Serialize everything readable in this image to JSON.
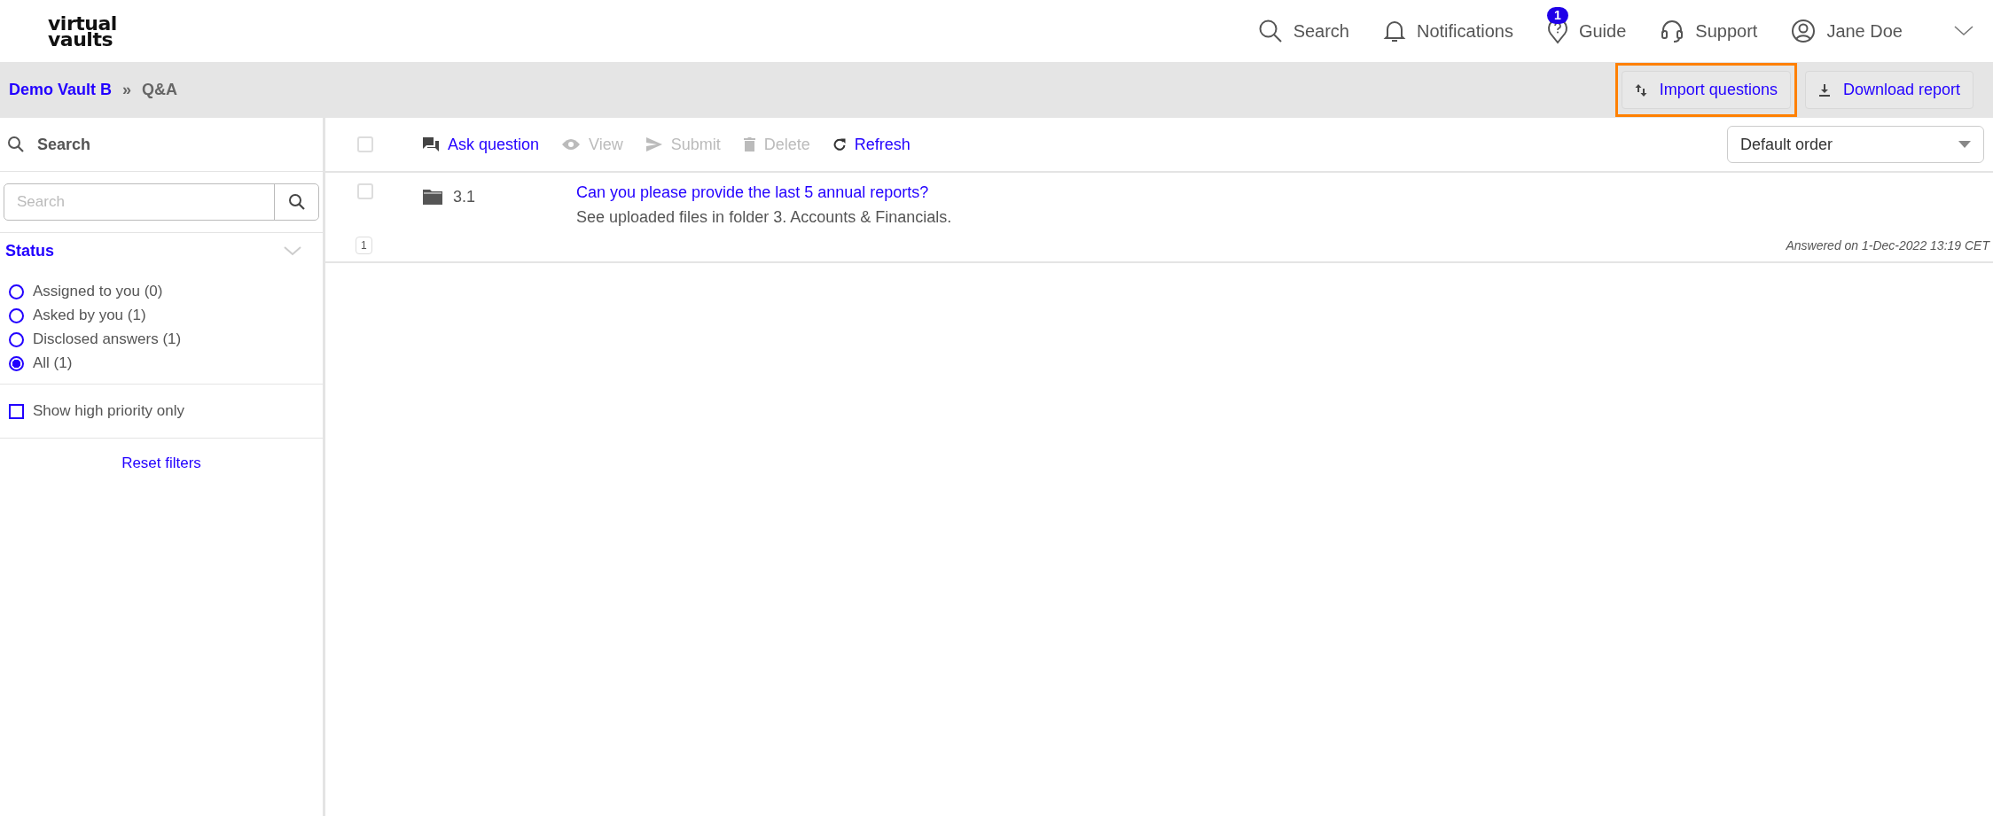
{
  "logo": {
    "lines": [
      "virtual",
      "vaults"
    ]
  },
  "nav": [
    {
      "kind": "search",
      "label": "Search"
    },
    {
      "kind": "bell",
      "label": "Notifications"
    },
    {
      "kind": "guide",
      "label": "Guide",
      "badge": "1"
    },
    {
      "kind": "headset",
      "label": "Support"
    },
    {
      "kind": "user",
      "label": "Jane Doe"
    }
  ],
  "breadcrumb": {
    "parent": "Demo Vault B",
    "separator": "»",
    "current": "Q&A"
  },
  "header_actions": [
    {
      "kind": "import",
      "label": "Import questions",
      "highlighted": true
    },
    {
      "kind": "download",
      "label": "Download report",
      "highlighted": false
    }
  ],
  "sidebar": {
    "title": "Search",
    "search": {
      "placeholder": "Search"
    },
    "status_title": "Status",
    "options": [
      {
        "label": "Assigned to you (0)",
        "selected": false
      },
      {
        "label": "Asked by you (1)",
        "selected": false
      },
      {
        "label": "Disclosed answers (1)",
        "selected": false
      },
      {
        "label": "All (1)",
        "selected": true
      }
    ],
    "priority": {
      "label": "Show high priority only",
      "checked": false
    },
    "reset": "Reset filters"
  },
  "toolbar": {
    "select_all_checked": false,
    "actions": [
      {
        "kind": "ask",
        "label": "Ask question",
        "disabled": false
      },
      {
        "kind": "view",
        "label": "View",
        "disabled": true
      },
      {
        "kind": "submit",
        "label": "Submit",
        "disabled": true
      },
      {
        "kind": "delete",
        "label": "Delete",
        "disabled": true
      },
      {
        "kind": "refresh",
        "label": "Refresh",
        "disabled": false
      }
    ],
    "sort": {
      "value": "Default order"
    }
  },
  "rows": [
    {
      "checked": false,
      "number": "3.1",
      "question": "Can you please provide the last 5 annual reports?",
      "answer": "See uploaded files in folder 3. Accounts & Financials.",
      "count": "1",
      "answered": "Answered on 1-Dec-2022 13:19 CET"
    }
  ]
}
